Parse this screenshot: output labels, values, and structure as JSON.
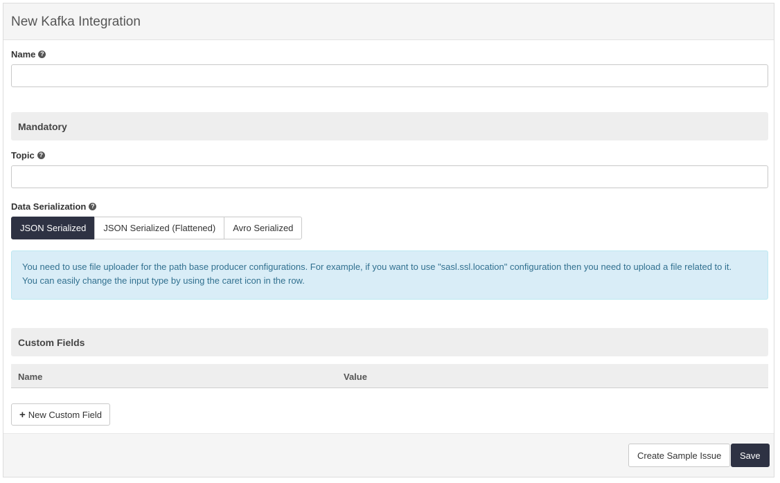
{
  "panel": {
    "title": "New Kafka Integration"
  },
  "name_field": {
    "label": "Name",
    "value": "",
    "placeholder": ""
  },
  "mandatory": {
    "title": "Mandatory"
  },
  "topic_field": {
    "label": "Topic",
    "value": "",
    "placeholder": ""
  },
  "serialization": {
    "label": "Data Serialization",
    "options": [
      "JSON Serialized",
      "JSON Serialized (Flattened)",
      "Avro Serialized"
    ],
    "selected": "JSON Serialized"
  },
  "info": {
    "line1": "You need to use file uploader for the path base producer configurations. For example, if you want to use \"sasl.ssl.location\" configuration then you need to upload a file related to it.",
    "line2": "You can easily change the input type by using the caret icon in the row."
  },
  "custom_fields": {
    "title": "Custom Fields",
    "columns": [
      "Name",
      "Value"
    ],
    "add_label": "New Custom Field"
  },
  "footer": {
    "sample_label": "Create Sample Issue",
    "save_label": "Save"
  },
  "colors": {
    "primary": "#2e3243",
    "info_bg": "#d9edf7",
    "info_text": "#31708f"
  },
  "icons": {
    "help": "question-circle-icon",
    "add": "plus-icon"
  }
}
